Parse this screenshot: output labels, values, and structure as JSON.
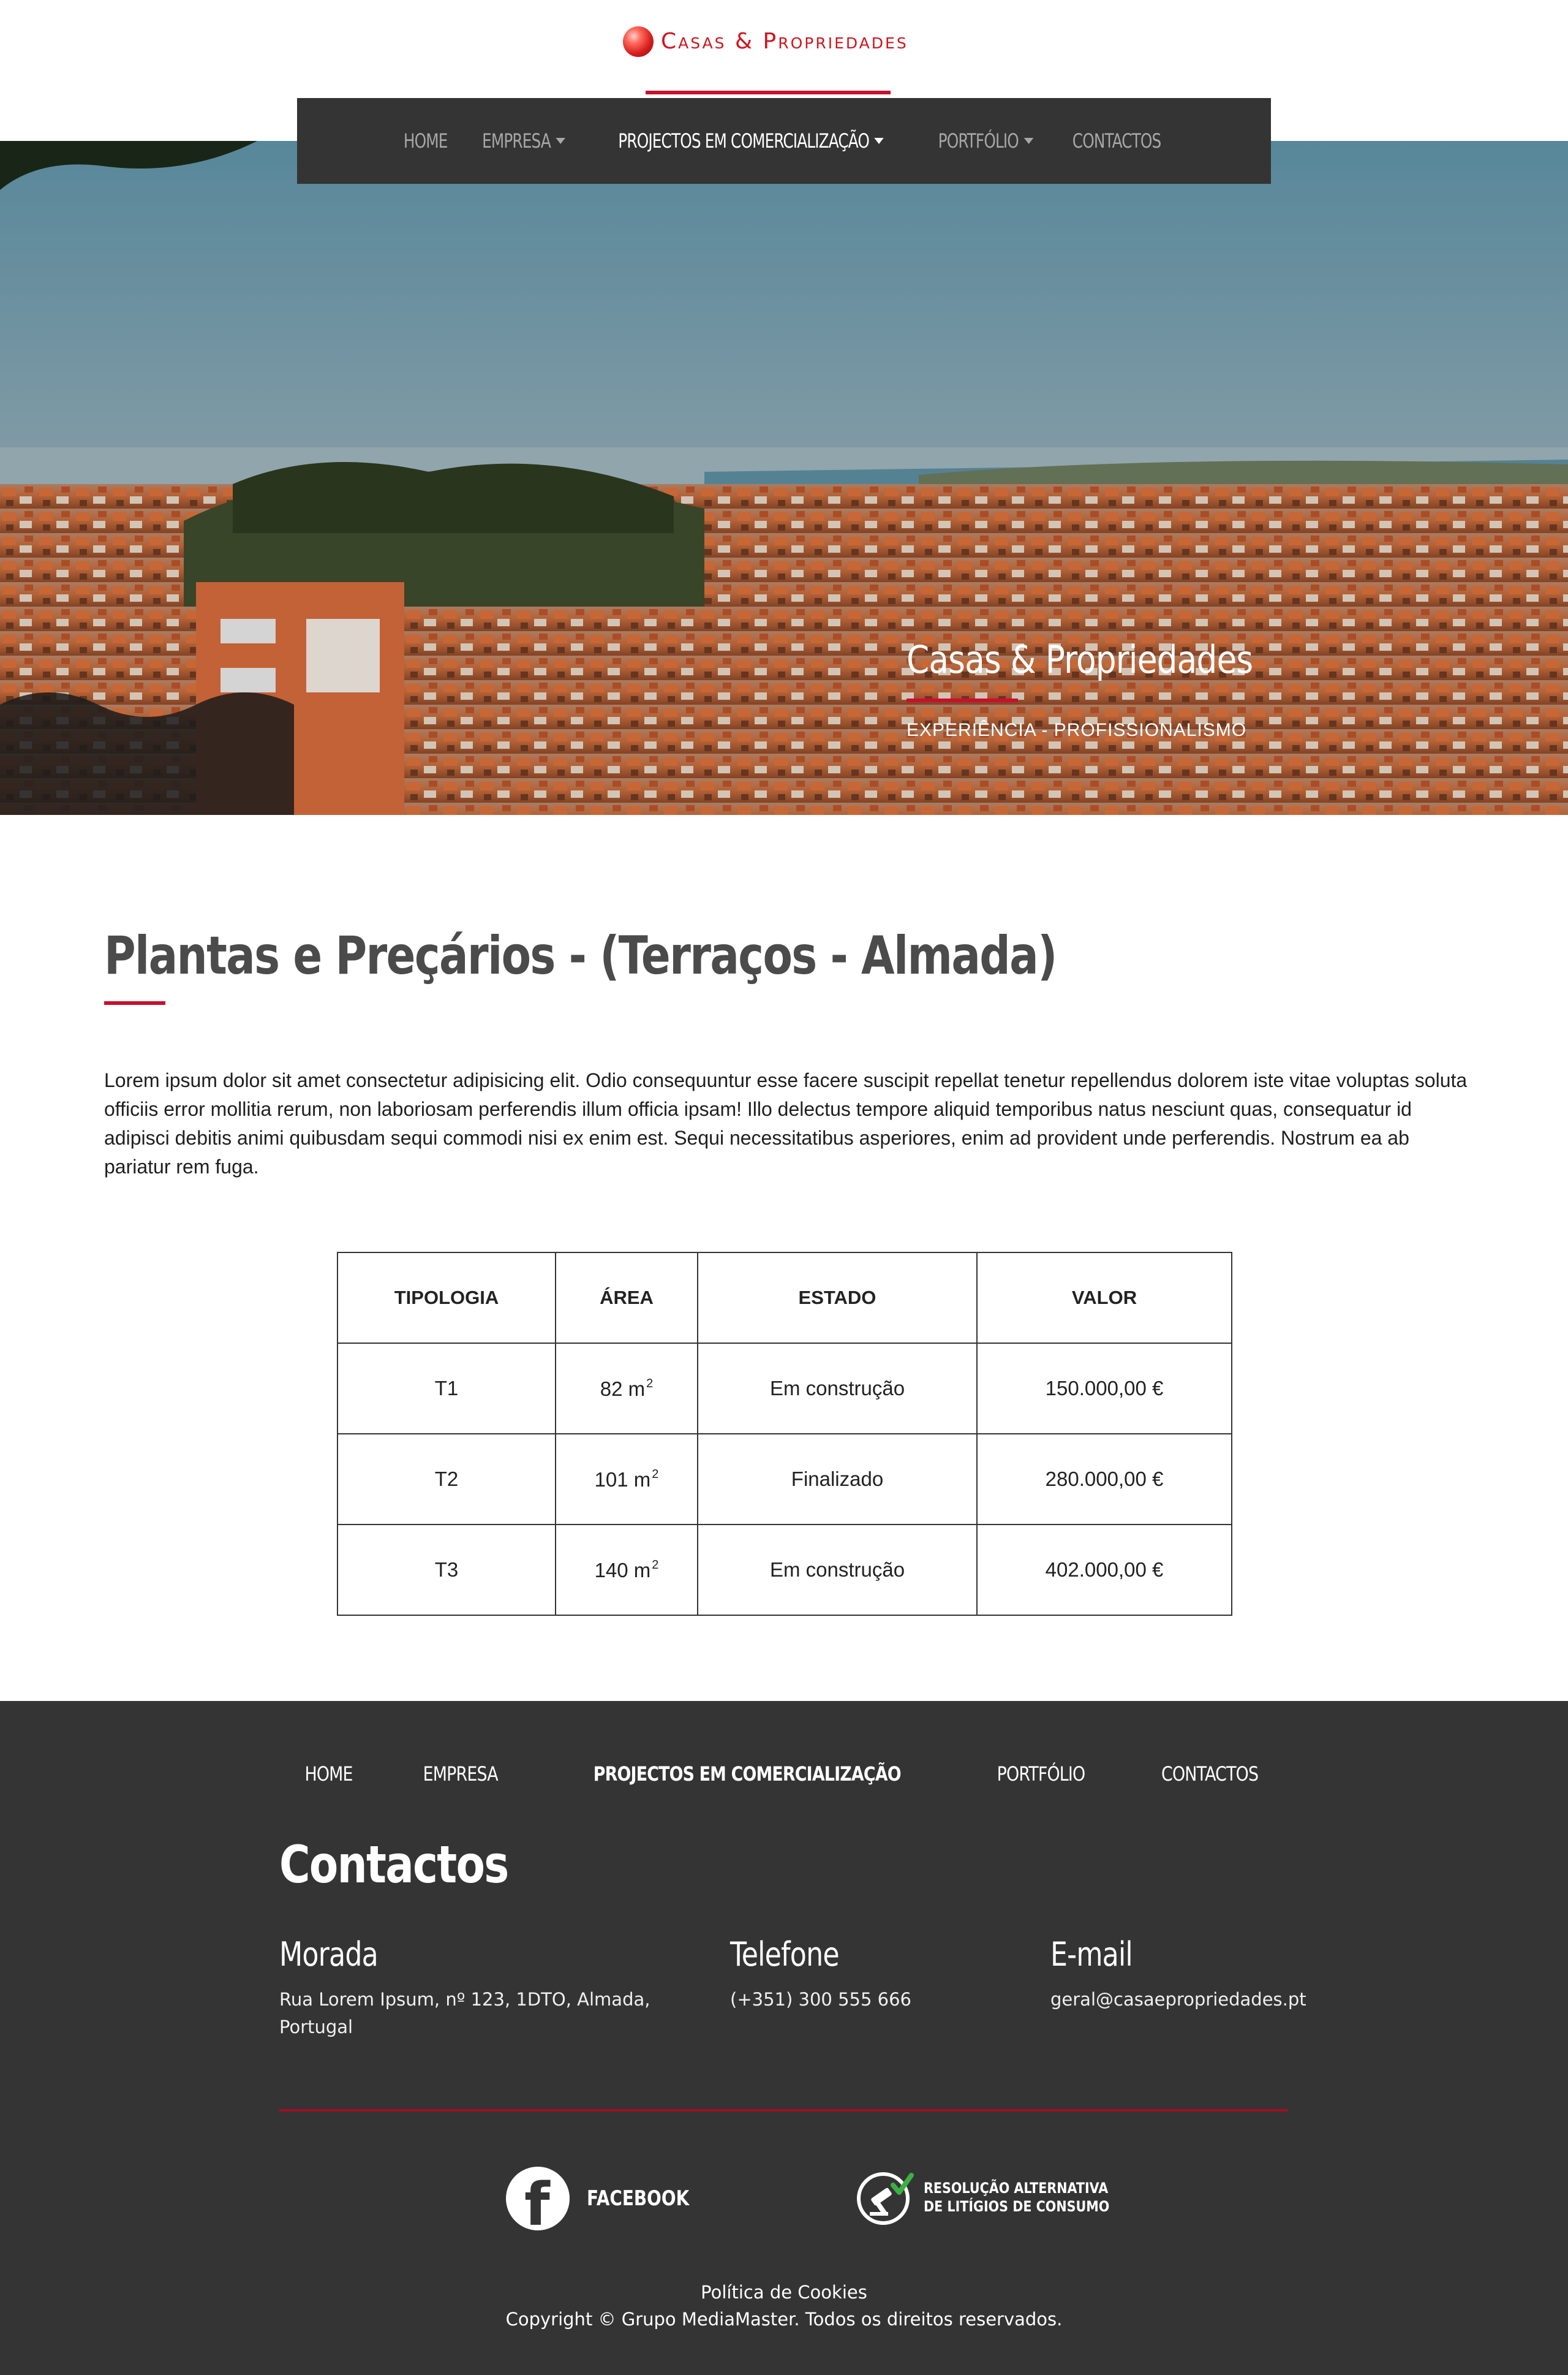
{
  "brand": {
    "name": "Casas & Propriedades",
    "accent_color": "#c8102e",
    "dark_color": "#343434"
  },
  "nav": {
    "items": [
      {
        "label": "HOME",
        "dropdown": false,
        "active": false
      },
      {
        "label": "EMPRESA",
        "dropdown": true,
        "active": false
      },
      {
        "label": "PROJECTOS EM COMERCIALIZAÇÃO",
        "dropdown": true,
        "active": true
      },
      {
        "label": "PORTFÓLIO",
        "dropdown": true,
        "active": false
      },
      {
        "label": "CONTACTOS",
        "dropdown": false,
        "active": false
      }
    ]
  },
  "hero": {
    "title": "Casas & Propriedades",
    "subtitle": "EXPERIÊNCIA - PROFISSIONALISMO"
  },
  "main": {
    "title": "Plantas e Preçários - (Terraços - Almada)",
    "intro": "Lorem ipsum dolor sit amet consectetur adipisicing elit. Odio consequuntur esse facere suscipit repellat tenetur repellendus dolorem iste vitae voluptas soluta officiis error mollitia rerum, non laboriosam perferendis illum officia ipsam! Illo delectus tempore aliquid temporibus natus nesciunt quas, consequatur id adipisci debitis animi quibusdam sequi commodi nisi ex enim est. Sequi necessitatibus asperiores, enim ad provident unde perferendis. Nostrum ea ab pariatur rem fuga.",
    "table": {
      "headers": [
        "TIPOLOGIA",
        "ÁREA",
        "ESTADO",
        "VALOR"
      ],
      "rows": [
        {
          "tipologia": "T1",
          "area": "82 m",
          "area_unit_exp": "2",
          "estado": "Em construção",
          "valor": "150.000,00 €"
        },
        {
          "tipologia": "T2",
          "area": "101 m",
          "area_unit_exp": "2",
          "estado": "Finalizado",
          "valor": "280.000,00 €"
        },
        {
          "tipologia": "T3",
          "area": "140 m",
          "area_unit_exp": "2",
          "estado": "Em construção",
          "valor": "402.000,00 €"
        }
      ]
    }
  },
  "footer": {
    "nav": [
      "HOME",
      "EMPRESA",
      "PROJECTOS EM COMERCIALIZAÇÃO",
      "PORTFÓLIO",
      "CONTACTOS"
    ],
    "contacts_title": "Contactos",
    "morada": {
      "label": "Morada",
      "value": "Rua Lorem Ipsum, nº 123, 1DTO, Almada, Portugal"
    },
    "telefone": {
      "label": "Telefone",
      "value": "(+351) 300 555 666"
    },
    "email": {
      "label": "E-mail",
      "value": "geral@casaepropriedades.pt"
    },
    "facebook_label": "FACEBOOK",
    "ral_line1": "RESOLUÇÃO ALTERNATIVA",
    "ral_line2": "DE LITÍGIOS DE CONSUMO",
    "cookies": "Política de Cookies",
    "copyright": "Copyright © Grupo MediaMaster. Todos os direitos reservados."
  }
}
